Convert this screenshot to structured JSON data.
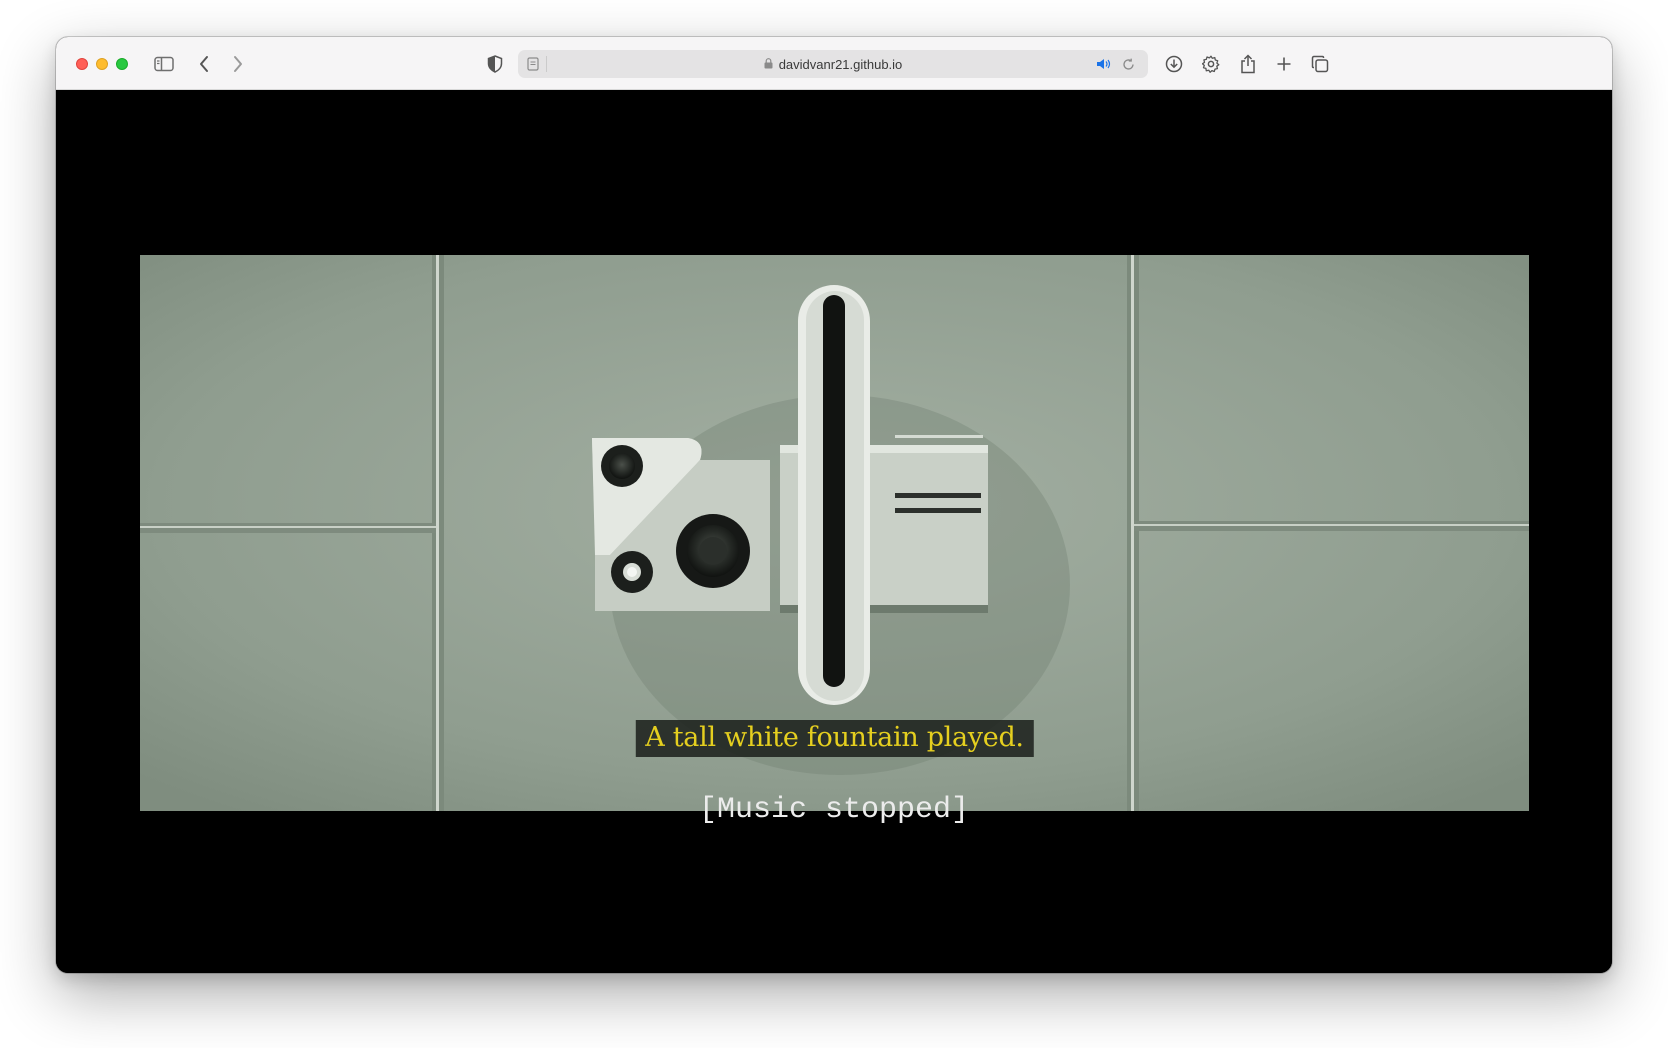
{
  "browser": {
    "url": "davidvanr21.github.io",
    "icons": {
      "close": "close-dot",
      "minimize": "minimize-dot",
      "maximize": "maximize-dot",
      "sidebar": "sidebar-toggle-icon",
      "back": "chevron-left-icon",
      "forward": "chevron-right-icon",
      "privacy": "shield-half-icon",
      "page": "page-icon",
      "lock": "lock-icon",
      "audio": "speaker-icon",
      "reload": "reload-icon",
      "downloads": "download-circle-icon",
      "settings": "gear-icon",
      "share": "share-icon",
      "new_tab": "plus-icon",
      "tabs": "tab-overview-icon"
    },
    "accent": "#1a73e8"
  },
  "player": {
    "caption": "A tall white fountain played.",
    "status": "[Music stopped]"
  },
  "colors": {
    "caption_text": "#e5cf1f",
    "caption_bg": "#1e221e",
    "background": "#000000",
    "status_text": "#ececec"
  }
}
